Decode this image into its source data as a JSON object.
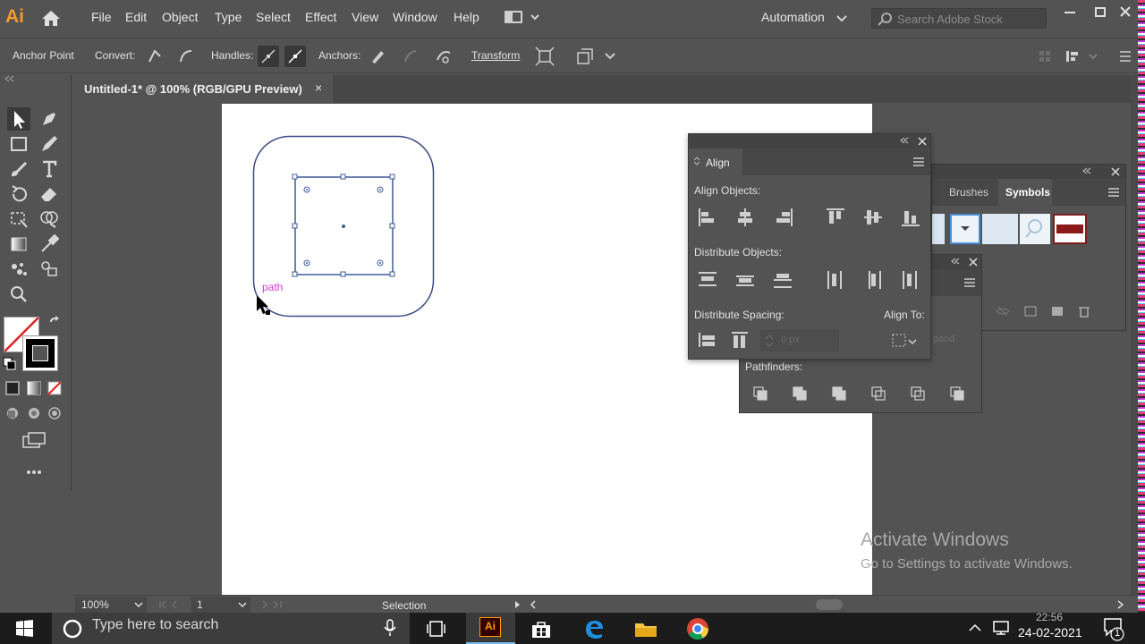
{
  "app": {
    "logo": "Ai"
  },
  "menu": [
    "File",
    "Edit",
    "Object",
    "Type",
    "Select",
    "Effect",
    "View",
    "Window",
    "Help"
  ],
  "workspace": "Automation",
  "stock_search_placeholder": "Search Adobe Stock",
  "control_bar": {
    "mode_label": "Anchor Point",
    "convert_label": "Convert:",
    "handles_label": "Handles:",
    "anchors_label": "Anchors:",
    "transform_label": "Transform"
  },
  "document_tab": {
    "title": "Untitled-1* @ 100% (RGB/GPU Preview)",
    "close": "×"
  },
  "canvas": {
    "cursor_hint": "path"
  },
  "align_panel": {
    "title": "Align",
    "align_objects_label": "Align Objects:",
    "distribute_objects_label": "Distribute Objects:",
    "distribute_spacing_label": "Distribute Spacing:",
    "align_to_label": "Align To:",
    "spacing_value": "0 px",
    "expand_label": "pand"
  },
  "symbols_panel": {
    "tabs": [
      "Brushes",
      "Symbols"
    ],
    "active_tab": "Symbols"
  },
  "pathfinder_panel": {
    "pathfinders_label": "Pathfinders:"
  },
  "status_bar": {
    "zoom": "100%",
    "artboard": "1",
    "tool": "Selection"
  },
  "watermark": {
    "line1": "Activate Windows",
    "line2": "Go to Settings to activate Windows."
  },
  "taskbar": {
    "search_placeholder": "Type here to search",
    "date": "24-02-2021",
    "time": "22:56",
    "notifications": "1"
  },
  "colors": {
    "accent_orange": "#f29a2e",
    "ui_gray": "#535353",
    "selection_blue": "#3d5a9c",
    "path_magenta": "#d63ad6"
  }
}
